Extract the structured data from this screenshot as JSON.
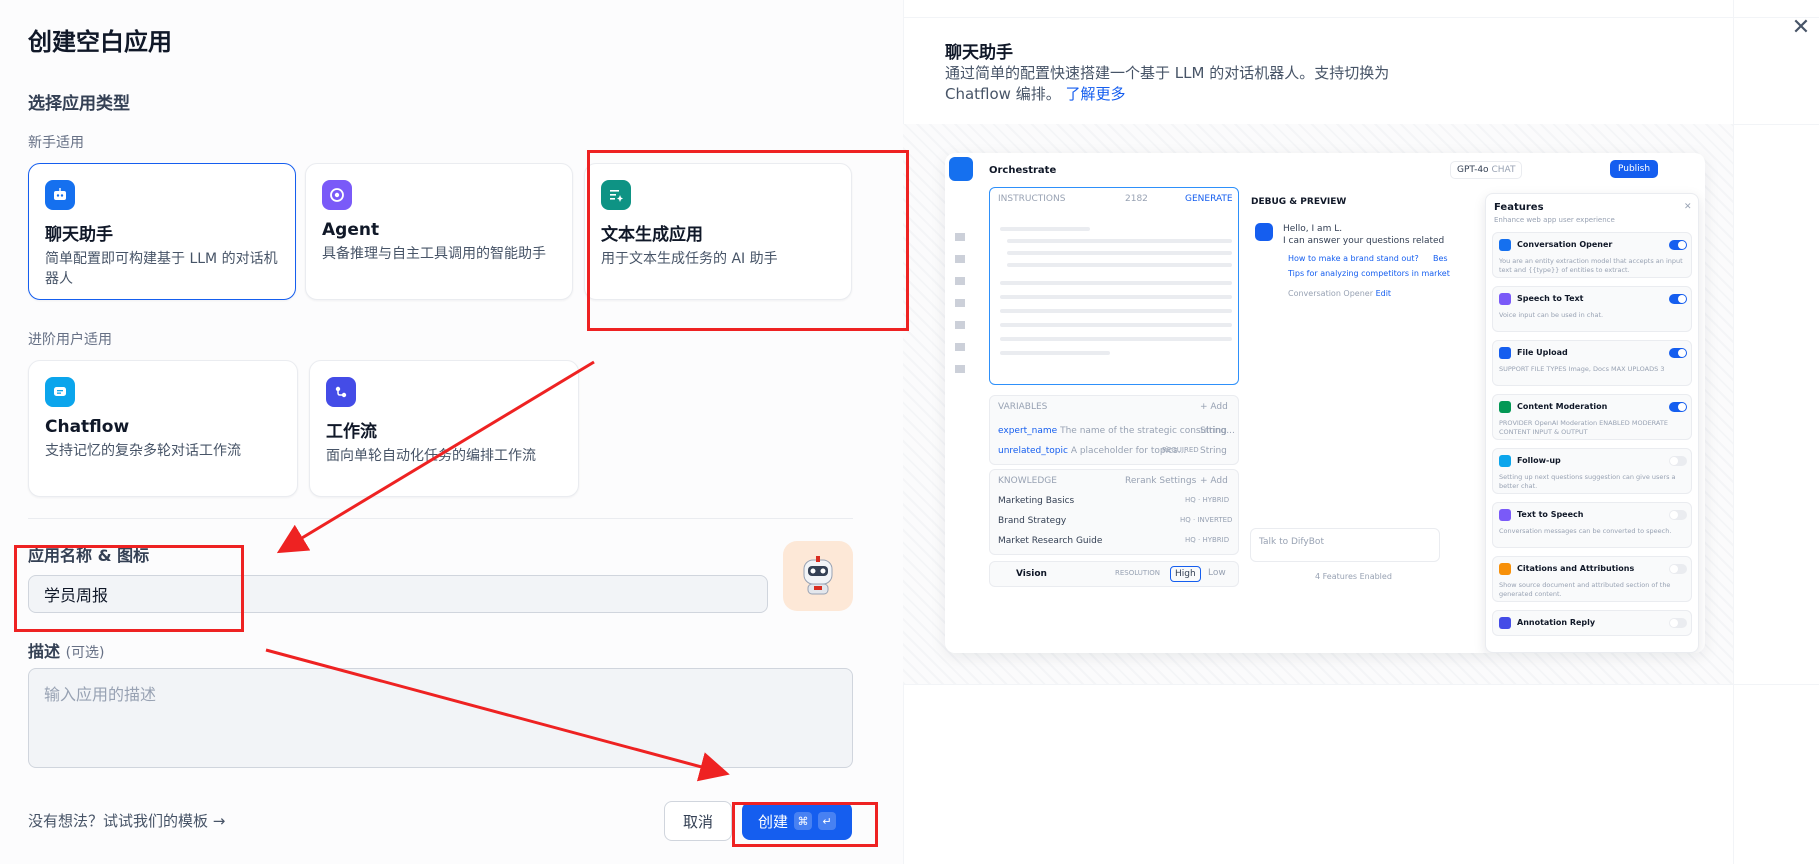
{
  "dialog": {
    "title": "创建空白应用",
    "section_title": "选择应用类型",
    "group_beginner": "新手适用",
    "group_advanced": "进阶用户适用",
    "cards": [
      {
        "title": "聊天助手",
        "desc": "简单配置即可构建基于 LLM 的对话机器人",
        "icon": "chat-bot-icon",
        "color": "#1570ef",
        "selected": true
      },
      {
        "title": "Agent",
        "desc": "具备推理与自主工具调用的智能助手",
        "icon": "agent-icon",
        "color": "#7a5af8"
      },
      {
        "title": "文本生成应用",
        "desc": "用于文本生成任务的 AI 助手",
        "icon": "text-generation-icon",
        "color": "#0e9384"
      },
      {
        "title": "Chatflow",
        "desc": "支持记忆的复杂多轮对话工作流",
        "icon": "chatflow-icon",
        "color": "#0ba5ec"
      },
      {
        "title": "工作流",
        "desc": "面向单轮自动化任务的编排工作流",
        "icon": "workflow-icon",
        "color": "#444ce7"
      }
    ],
    "name_label": "应用名称 & 图标",
    "name_value": "学员周报",
    "desc_label": "描述",
    "desc_optional": "(可选)",
    "desc_placeholder": "输入应用的描述",
    "template_link": "没有想法？试试我们的模板 →",
    "cancel": "取消",
    "create": "创建",
    "create_kbd": [
      "⌘",
      "↵"
    ]
  },
  "preview": {
    "title": "聊天助手",
    "desc": "通过简单的配置快速搭建一个基于 LLM 的对话机器人。支持切换为 Chatflow 编排。",
    "learn_more": "了解更多",
    "mock": {
      "header": "Orchestrate",
      "model": "GPT-4o",
      "model_tag": "CHAT",
      "publish": "Publish",
      "instructions": "INSTRUCTIONS",
      "instr_count": "2182",
      "generate": "GENERATE",
      "debug": "DEBUG & PREVIEW",
      "hello": "Hello, I am L.",
      "hello2": "I can answer your questions related",
      "q1": "How to make a brand stand out?",
      "q1b": "Bes",
      "q2": "Tips for analyzing competitors in market",
      "opener": "Conversation Opener",
      "edit": "Edit",
      "variables": "VARIABLES",
      "add": "+ Add",
      "var1": "expert_name",
      "var1d": "The name of the strategic consulting...",
      "var1t": "String",
      "var2": "unrelated_topic",
      "var2d": "A placeholder for topics...",
      "required": "REQUIRED",
      "var2t": "String",
      "knowledge": "KNOWLEDGE",
      "rerank": "Rerank Settings",
      "k1": "Marketing Basics",
      "k1t": "HQ · HYBRID",
      "k2": "Brand Strategy",
      "k2t": "HQ · INVERTED",
      "k3": "Market Research Guide",
      "k3t": "HQ · HYBRID",
      "vision": "Vision",
      "resolution": "RESOLUTION",
      "high": "High",
      "low": "Low",
      "talk": "Talk to DifyBot",
      "enabled": "4 Features Enabled",
      "features": "Features",
      "features_sub": "Enhance web app user experience",
      "feature_items": [
        {
          "name": "Conversation Opener",
          "desc": "You are an entity extraction model that accepts an input text and {{type}} of entities to extract.",
          "on": true,
          "color": "#1570ef"
        },
        {
          "name": "Speech to Text",
          "desc": "Voice input can be used in chat.",
          "on": true,
          "color": "#7a5af8"
        },
        {
          "name": "File Upload",
          "desc": "SUPPORT FILE TYPES  Image, Docs    MAX UPLOADS 3",
          "on": true,
          "color": "#155eef"
        },
        {
          "name": "Content Moderation",
          "desc": "PROVIDER OpenAI Moderation   ENABLED MODERATE CONTENT INPUT & OUTPUT",
          "on": true,
          "color": "#039855"
        },
        {
          "name": "Follow-up",
          "desc": "Setting up next questions suggestion can give users a better chat.",
          "on": false,
          "color": "#0ba5ec"
        },
        {
          "name": "Text to Speech",
          "desc": "Conversation messages can be converted to speech.",
          "on": false,
          "color": "#7a5af8"
        },
        {
          "name": "Citations and Attributions",
          "desc": "Show source document and attributed section of the generated content.",
          "on": false,
          "color": "#f79009"
        },
        {
          "name": "Annotation Reply",
          "desc": "",
          "on": false,
          "color": "#444ce7"
        }
      ]
    }
  }
}
